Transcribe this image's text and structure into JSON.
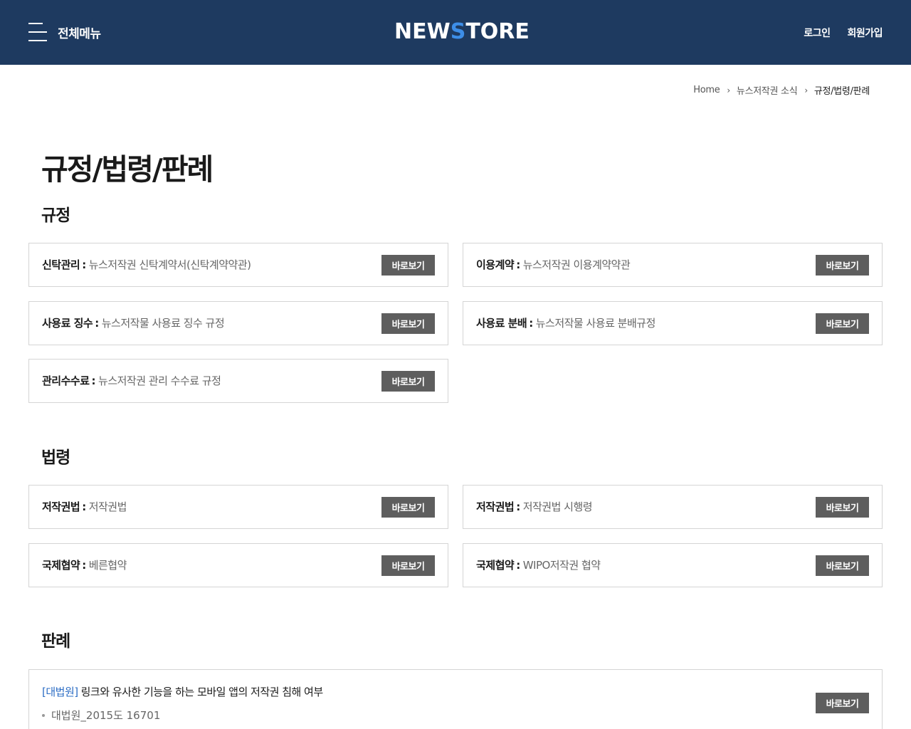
{
  "header": {
    "menu_label": "전체메뉴",
    "logo_part1": "NEW",
    "logo_accent": "S",
    "logo_part2": "TORE",
    "login": "로그인",
    "signup": "회원가입",
    "bg_color": "#1e3a60",
    "accent_color": "#3d8ee8"
  },
  "breadcrumb": {
    "home": "Home",
    "level1": "뉴스저작권 소식",
    "current": "규정/법령/판례"
  },
  "page_title": "규정/법령/판례",
  "view_button": "바로보기",
  "sections": {
    "rules": {
      "title": "규정",
      "items": [
        {
          "label": "신탁관리",
          "desc": "뉴스저작권 신탁계약서(신탁계약약관)"
        },
        {
          "label": "이용계약",
          "desc": "뉴스저작권 이용계약약관"
        },
        {
          "label": "사용료 징수",
          "desc": "뉴스저작물 사용료 징수 규정"
        },
        {
          "label": "사용료 분배",
          "desc": "뉴스저작물 사용료 분배규정"
        },
        {
          "label": "관리수수료",
          "desc": "뉴스저작권 관리 수수료 규정"
        }
      ]
    },
    "laws": {
      "title": "법령",
      "items": [
        {
          "label": "저작권법",
          "desc": "저작권법"
        },
        {
          "label": "저작권법",
          "desc": "저작권법 시행령"
        },
        {
          "label": "국제협약",
          "desc": "베른협약"
        },
        {
          "label": "국제협약",
          "desc": "WIPO저작권 협약"
        }
      ]
    },
    "cases": {
      "title": "판례",
      "items": [
        {
          "tag": "[대법원]",
          "title": "링크와 유사한 기능을 하는 모바일 앱의 저작권 침해 여부",
          "meta": "대법원_2015도 16701"
        }
      ]
    }
  }
}
